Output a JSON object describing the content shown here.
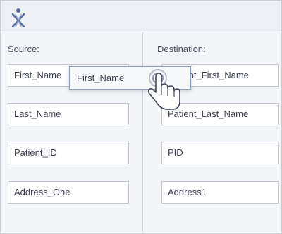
{
  "source": {
    "title": "Source:",
    "fields": [
      "First_Name",
      "Last_Name",
      "Patient_ID",
      "Address_One"
    ]
  },
  "destination": {
    "title": "Destination:",
    "fields": [
      "Patient_First_Name",
      "Patient_Last_Name",
      "PID",
      "Address1"
    ]
  },
  "drag": {
    "label": "First_Name"
  },
  "icons": {
    "logo": "person-x-logo-icon",
    "cursor": "hand-pointer-icon"
  }
}
